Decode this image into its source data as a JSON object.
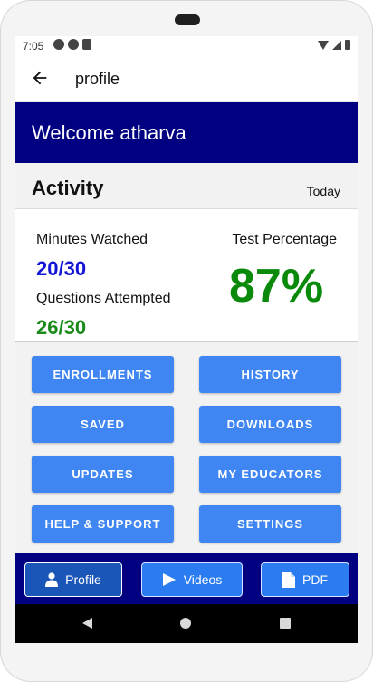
{
  "status_bar": {
    "time": "7:05"
  },
  "app_bar": {
    "title": "profile"
  },
  "welcome": {
    "text": "Welcome atharva"
  },
  "activity": {
    "title": "Activity",
    "period": "Today",
    "minutes_watched": {
      "label": "Minutes Watched",
      "value": "20/30"
    },
    "questions_attempted": {
      "label": "Questions Attempted",
      "value": "26/30"
    },
    "test_percentage": {
      "label": "Test Percentage",
      "value": "87%"
    }
  },
  "buttons": [
    {
      "label": "ENROLLMENTS"
    },
    {
      "label": "HISTORY"
    },
    {
      "label": "SAVED"
    },
    {
      "label": "DOWNLOADS"
    },
    {
      "label": "UPDATES"
    },
    {
      "label": "MY EDUCATORS"
    },
    {
      "label": "HELP & SUPPORT"
    },
    {
      "label": "SETTINGS"
    }
  ],
  "bottom_nav": {
    "items": [
      {
        "label": "Profile",
        "icon": "person-icon",
        "selected": true
      },
      {
        "label": "Videos",
        "icon": "play-icon",
        "selected": false
      },
      {
        "label": "PDF",
        "icon": "document-icon",
        "selected": false
      }
    ]
  },
  "colors": {
    "header": "#000080",
    "button": "#3f86f2",
    "minutes_value": "#1515d6",
    "questions_value": "#1a8a1a",
    "percentage_value": "#0a8a0a"
  }
}
